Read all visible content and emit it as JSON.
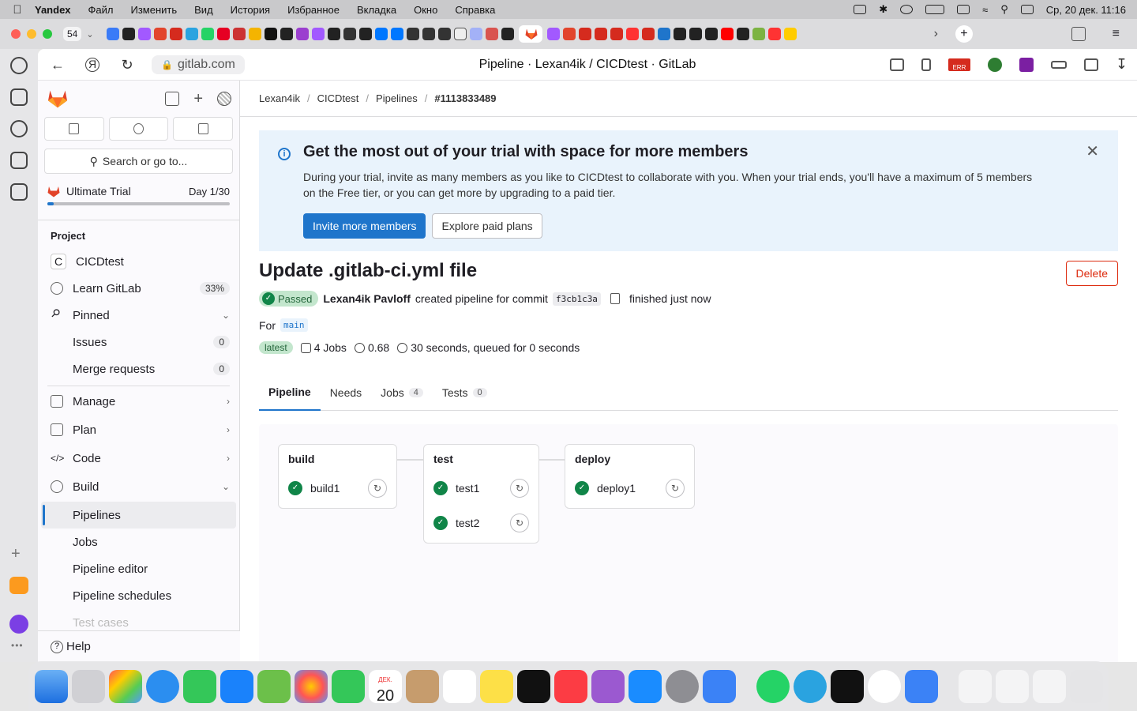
{
  "menubar": {
    "app_name": "Yandex",
    "items": [
      "Файл",
      "Изменить",
      "Вид",
      "История",
      "Избранное",
      "Вкладка",
      "Окно",
      "Справка"
    ],
    "clock": "Ср, 20 дек.  11:16"
  },
  "browser": {
    "tab_count": "54",
    "url": "gitlab.com",
    "page_title": "Pipeline · Lexan4ik / CICDtest · GitLab"
  },
  "sidebar": {
    "search_placeholder": "Search or go to...",
    "trial": {
      "label": "Ultimate Trial",
      "day": "Day 1/30",
      "progress": 0.033
    },
    "section_title": "Project",
    "project": {
      "avatar_letter": "C",
      "name": "CICDtest"
    },
    "learn": {
      "label": "Learn GitLab",
      "badge": "33%"
    },
    "pinned": {
      "label": "Pinned"
    },
    "issues": {
      "label": "Issues",
      "count": "0"
    },
    "merge_requests": {
      "label": "Merge requests",
      "count": "0"
    },
    "manage": "Manage",
    "plan": "Plan",
    "code": "Code",
    "build": "Build",
    "pipelines": "Pipelines",
    "jobs": "Jobs",
    "pipeline_editor": "Pipeline editor",
    "pipeline_schedules": "Pipeline schedules",
    "test_cases": "Test cases",
    "help": "Help"
  },
  "breadcrumb": {
    "owner": "Lexan4ik",
    "project": "CICDtest",
    "section": "Pipelines",
    "current": "#1113833489"
  },
  "banner": {
    "title": "Get the most out of your trial with space for more members",
    "body": "During your trial, invite as many members as you like to CICDtest to collaborate with you. When your trial ends, you'll have a maximum of 5 members on the Free tier, or you can get more by upgrading to a paid tier.",
    "primary_button": "Invite more members",
    "secondary_button": "Explore paid plans"
  },
  "pipeline": {
    "title": "Update .gitlab-ci.yml file",
    "delete_label": "Delete",
    "status": "Passed",
    "author": "Lexan4ik Pavloff",
    "created_text": "created pipeline for commit",
    "commit": "f3cb1c3a",
    "finished_text": "finished just now",
    "for_label": "For",
    "branch": "main",
    "latest_badge": "latest",
    "jobs_count_text": "4 Jobs",
    "compute_text": "0.68",
    "duration_text": "30 seconds, queued for 0 seconds"
  },
  "tabs": [
    {
      "label": "Pipeline"
    },
    {
      "label": "Needs"
    },
    {
      "label": "Jobs",
      "count": "4"
    },
    {
      "label": "Tests",
      "count": "0"
    }
  ],
  "stages": [
    {
      "name": "build",
      "jobs": [
        "build1"
      ]
    },
    {
      "name": "test",
      "jobs": [
        "test1",
        "test2"
      ]
    },
    {
      "name": "deploy",
      "jobs": [
        "deploy1"
      ]
    }
  ],
  "dock": {
    "calendar_month": "ДЕК.",
    "calendar_day": "20"
  },
  "colors": {
    "brand_orange": "#e24329",
    "primary_blue": "#1f75cb",
    "success_green": "#108548",
    "danger_red": "#dd2b0e"
  }
}
